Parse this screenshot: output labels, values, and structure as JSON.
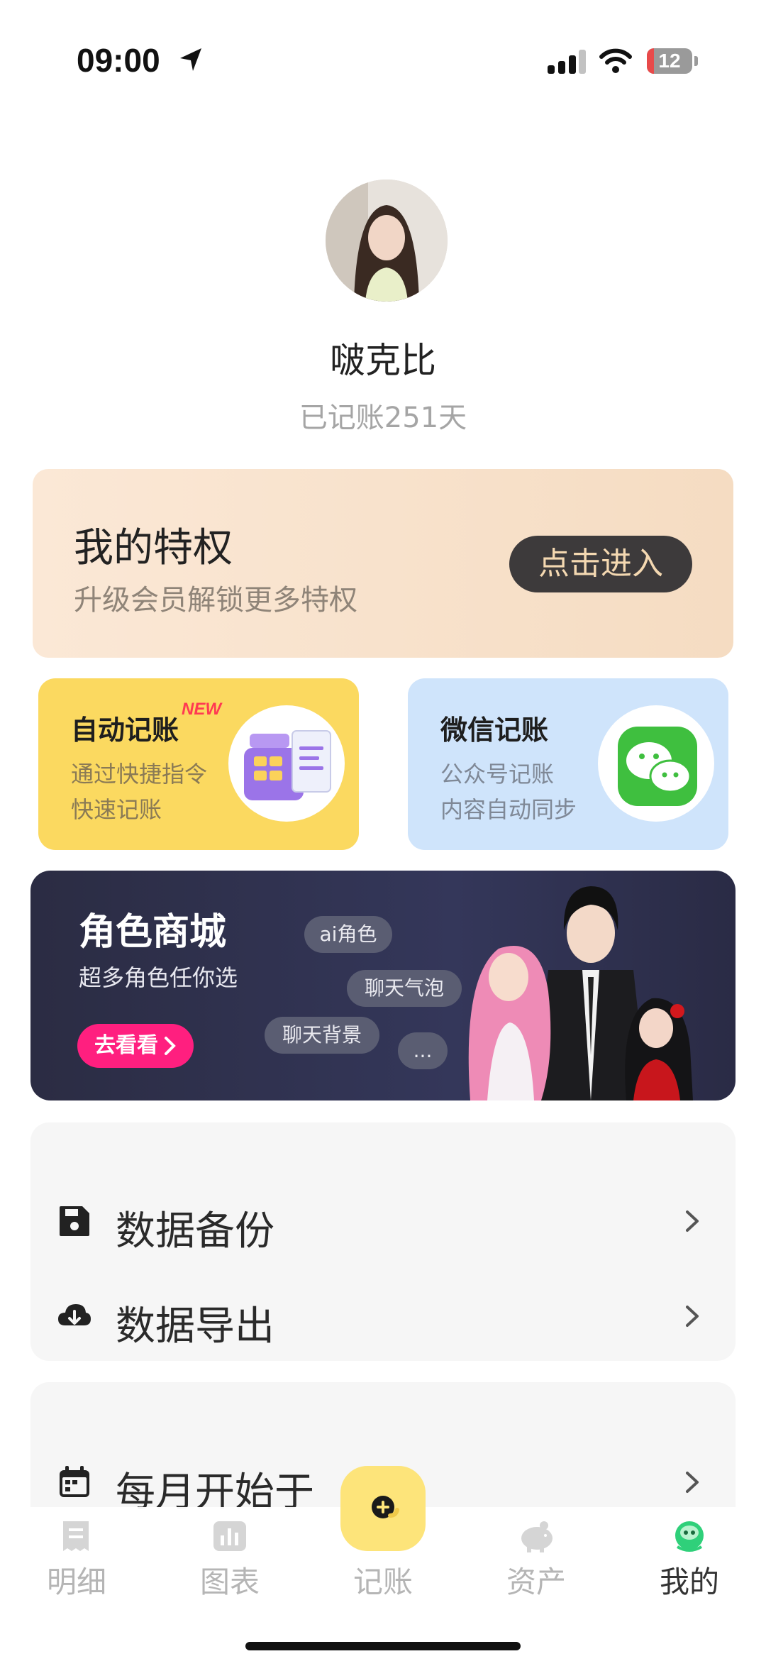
{
  "status_bar": {
    "time": "09:00",
    "battery": "12"
  },
  "profile": {
    "username": "啵克比",
    "days_text": "已记账251天"
  },
  "privilege": {
    "title": "我的特权",
    "subtitle": "升级会员解锁更多特权",
    "button": "点击进入"
  },
  "features": [
    {
      "title": "自动记账",
      "badge": "NEW",
      "desc_line1": "通过快捷指令",
      "desc_line2": "快速记账",
      "bg": "#fbd960"
    },
    {
      "title": "微信记账",
      "desc_line1": "公众号记账",
      "desc_line2": "内容自动同步",
      "bg": "#cfe4fb"
    }
  ],
  "banner": {
    "title": "角色商城",
    "subtitle": "超多角色任你选",
    "button": "去看看",
    "tags": [
      "ai角色",
      "聊天气泡",
      "聊天背景",
      "..."
    ]
  },
  "menu_group1": [
    {
      "label": "数据备份",
      "icon": "floppy-disk-icon"
    },
    {
      "label": "数据导出",
      "icon": "cloud-download-icon"
    }
  ],
  "menu_group2": [
    {
      "label": "每月开始于",
      "icon": "calendar-icon"
    }
  ],
  "tabbar": {
    "tabs": [
      {
        "label": "明细",
        "icon": "receipt-icon"
      },
      {
        "label": "图表",
        "icon": "chart-icon"
      },
      {
        "label": "记账",
        "icon": "add-icon"
      },
      {
        "label": "资产",
        "icon": "piggy-bank-icon"
      },
      {
        "label": "我的",
        "icon": "profile-icon"
      }
    ],
    "active": "我的"
  },
  "colors": {
    "accent_yellow": "#fde47a",
    "banner_button": "#ff1f7f",
    "privilege_button": "#3d3a3b"
  }
}
